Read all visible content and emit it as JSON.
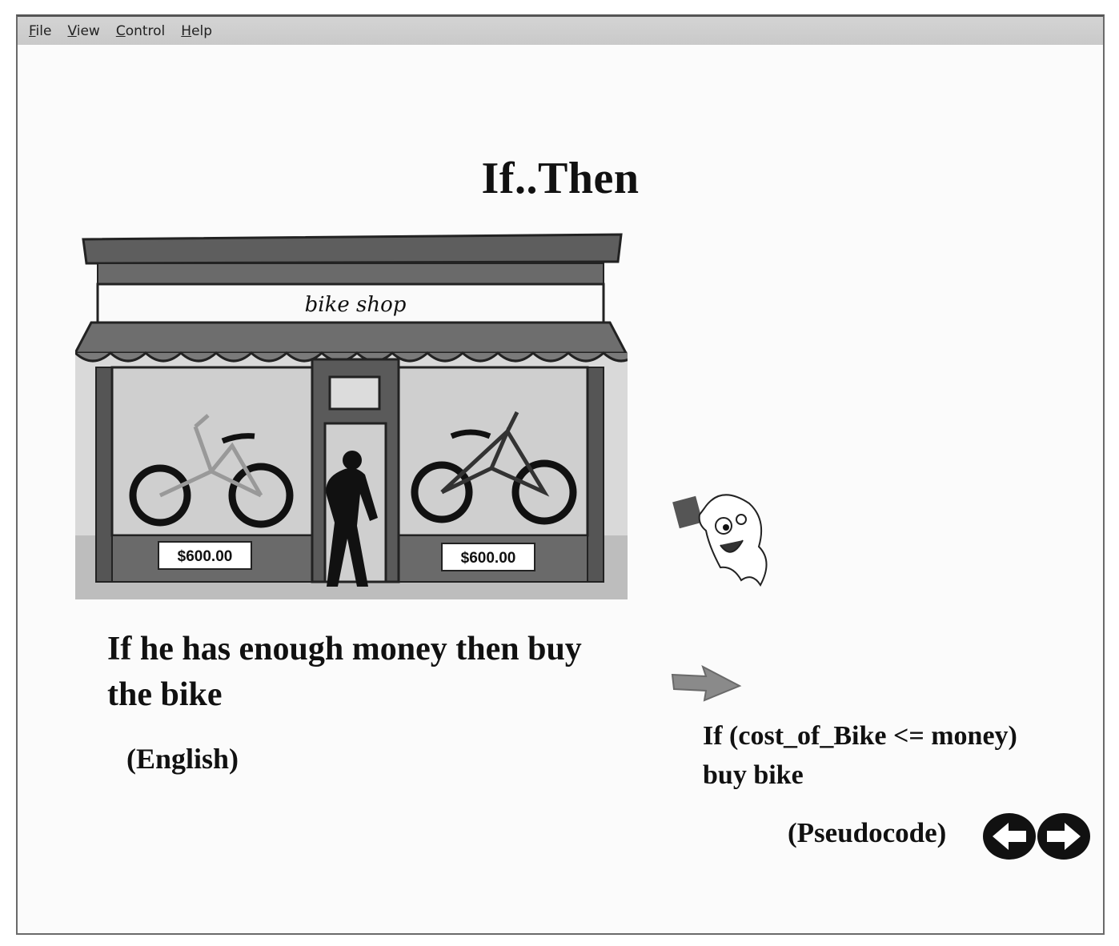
{
  "menubar": {
    "items": [
      "File",
      "View",
      "Control",
      "Help"
    ]
  },
  "slide": {
    "title": "If..Then",
    "shop_sign": "bike shop",
    "prices": [
      "$600.00",
      "$600.00"
    ],
    "english_text": "If he has enough money then buy the bike",
    "english_label": "(English)",
    "pseudocode_line1": "If (cost_of_Bike <= money)",
    "pseudocode_line2": "buy bike",
    "pseudocode_label": "(Pseudocode)"
  },
  "icons": {
    "prev": "arrow-left-icon",
    "next": "arrow-right-icon",
    "pointer": "arrow-right-icon",
    "mascot": "ghost-icon"
  },
  "colors": {
    "awning": "#6e6e6e",
    "window_glass": "#cfcfcf",
    "trim": "#3a3a3a"
  }
}
